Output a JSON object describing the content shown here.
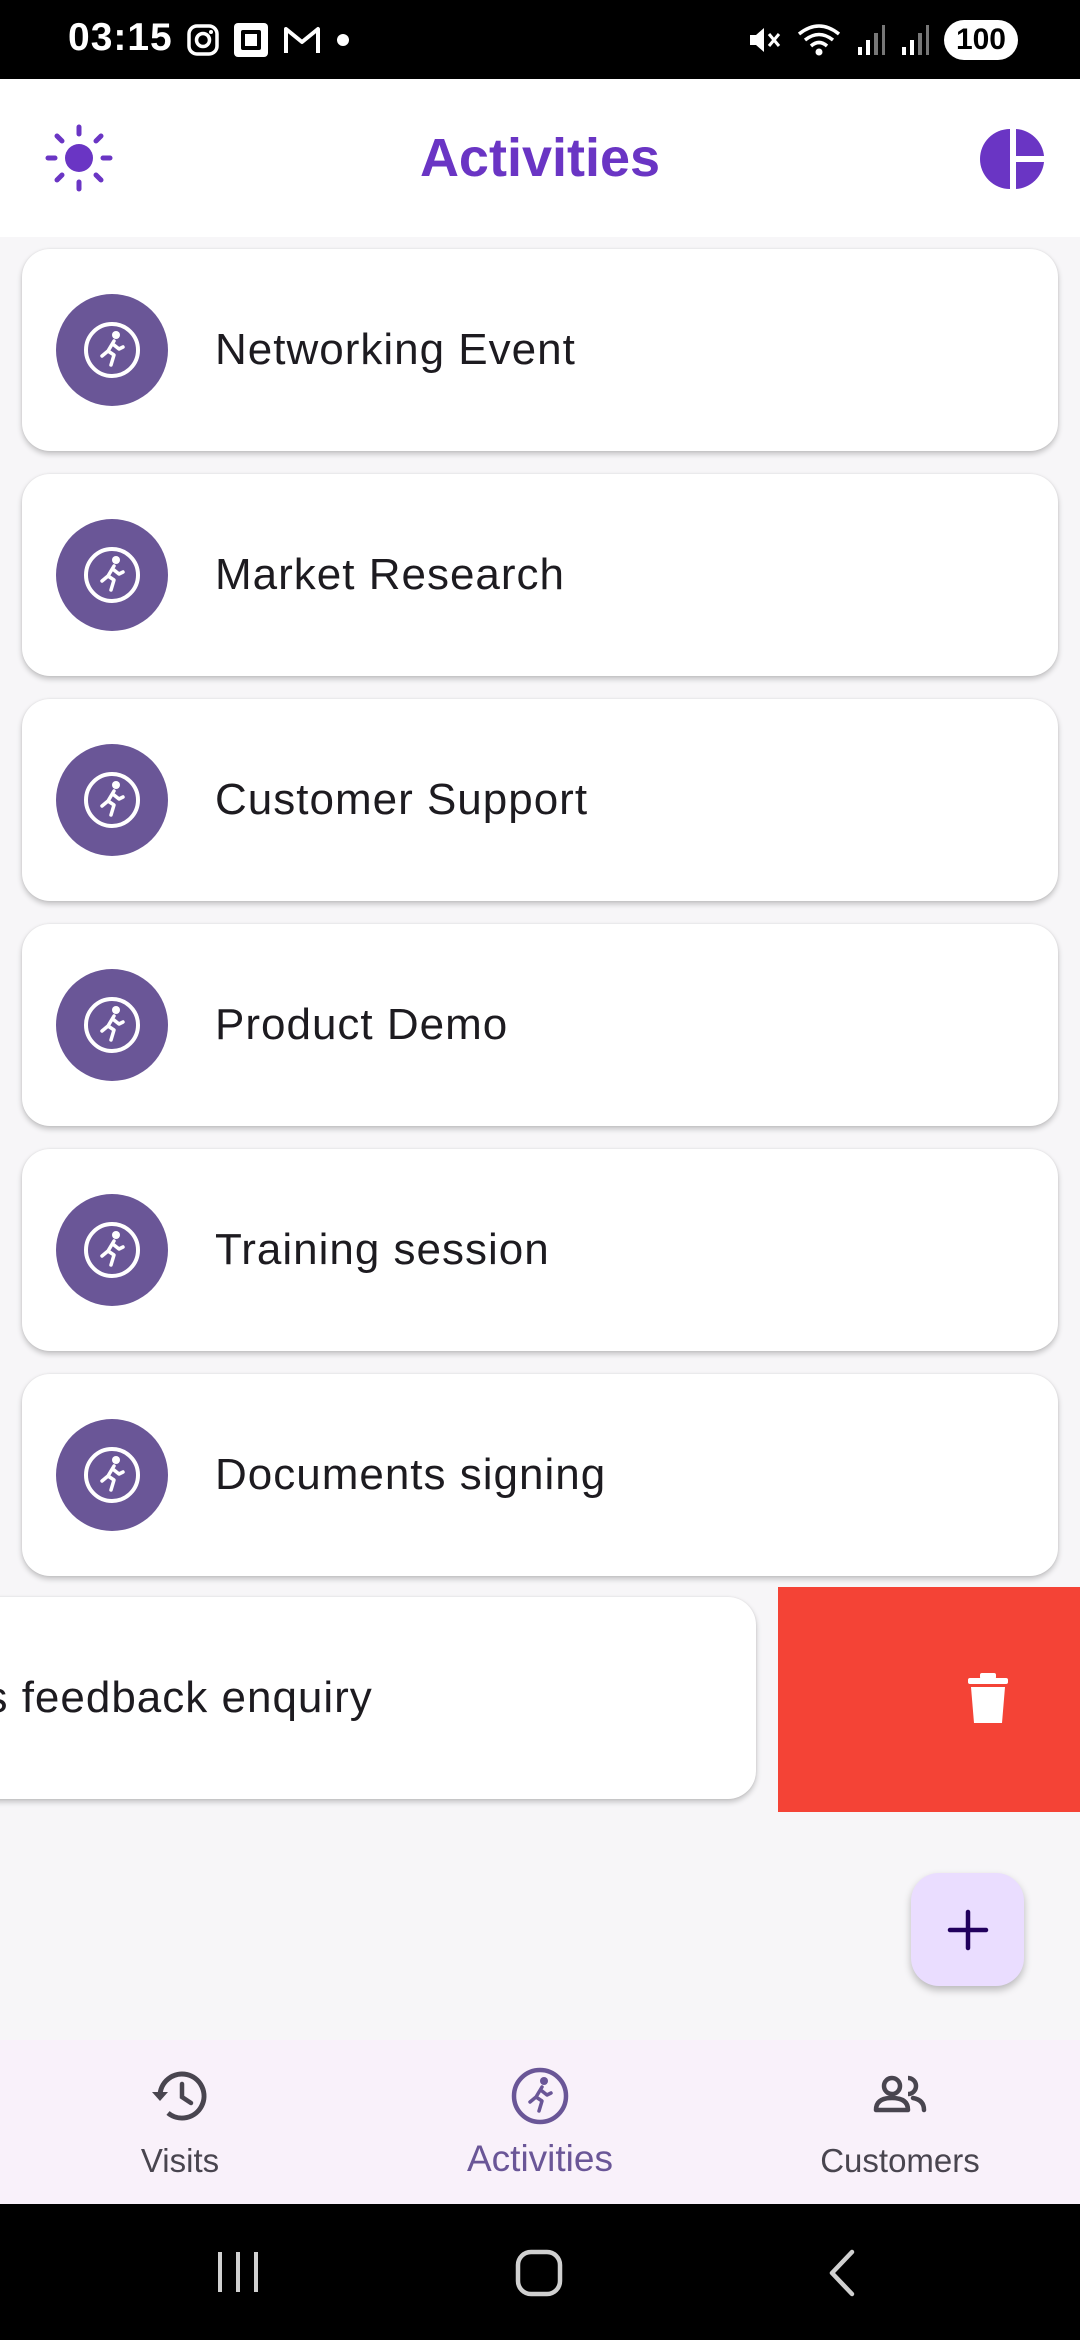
{
  "status_bar": {
    "time": "03:15",
    "battery": "100",
    "left_icons": [
      "instagram-icon",
      "screenshot-icon",
      "gmail-icon",
      "dot-icon"
    ],
    "right_icons": [
      "mute-icon",
      "wifi-icon",
      "signal-icon",
      "signal-icon"
    ]
  },
  "app_bar": {
    "title": "Activities",
    "left_icon": "sun-icon",
    "right_icon": "pie-chart-icon",
    "accent_color": "#6a35c4"
  },
  "activities": [
    {
      "label": "Networking Event",
      "icon": "directions-run-icon"
    },
    {
      "label": "Market Research",
      "icon": "directions-run-icon"
    },
    {
      "label": "Customer Support",
      "icon": "directions-run-icon"
    },
    {
      "label": "Product Demo",
      "icon": "directions-run-icon"
    },
    {
      "label": "Training session",
      "icon": "directions-run-icon"
    },
    {
      "label": "Documents signing",
      "icon": "directions-run-icon"
    }
  ],
  "swiped_item": {
    "label": "es feedback enquiry",
    "delete_icon": "trash-icon",
    "delete_color": "#f44336"
  },
  "fab": {
    "icon": "plus-icon"
  },
  "bottom_nav": {
    "items": [
      {
        "label": "Visits",
        "icon": "history-icon",
        "active": false
      },
      {
        "label": "Activities",
        "icon": "directions-run-icon",
        "active": true
      },
      {
        "label": "Customers",
        "icon": "people-icon",
        "active": false
      }
    ]
  },
  "system_nav": [
    "recents-icon",
    "home-icon",
    "back-icon"
  ]
}
